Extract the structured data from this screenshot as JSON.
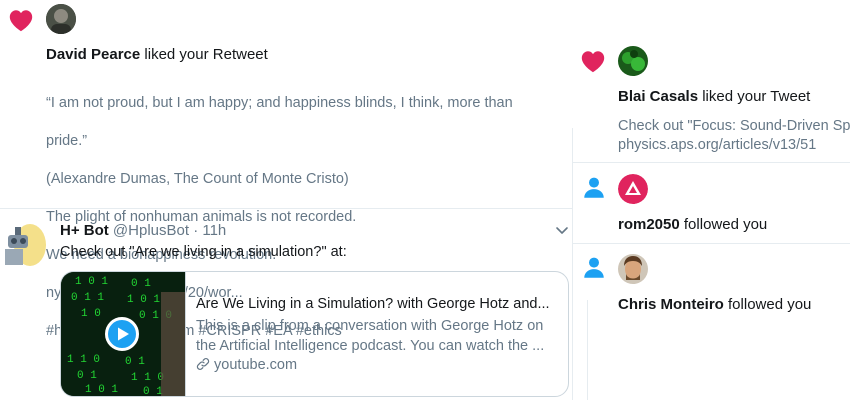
{
  "notif_retweet": {
    "user": "David Pearce",
    "action": "liked your Retweet",
    "lines": [
      "“I am not proud, but I am happy; and happiness blinds, I think, more than",
      "pride.”",
      "(Alexandre Dumas, The Count of Monte Cristo)",
      "The plight of nonhuman animals is not recorded.",
      "We need a biohappiness revolution.",
      "nytimes.com/2020/03/20/wor...",
      "#happiness #veganism #CRISPR #EA #ethics"
    ]
  },
  "tweet": {
    "name": "H+ Bot",
    "handle": "@HplusBot",
    "dot": "·",
    "time": "11h",
    "text": "Check out \"Are we living in a simulation?\" at:",
    "card": {
      "title": "Are We Living in a Simulation? with George Hotz and...",
      "desc_line1": "This is a clip from a conversation with George Hotz on",
      "desc_line2": "the Artificial Intelligence podcast. You can watch the ...",
      "domain": "youtube.com"
    }
  },
  "notif_like": {
    "user": "Blai Casals",
    "action": "liked your Tweet",
    "line1": "Check out \"Focus: Sound-Driven Sp",
    "line2": "physics.aps.org/articles/v13/51"
  },
  "notif_follow1": {
    "user": "rom2050",
    "action": "followed you"
  },
  "notif_follow2": {
    "user": "Chris Monteiro",
    "action": "followed you"
  },
  "colors": {
    "heart": "#e0245e",
    "follow_icon": "#1da1f2",
    "play": "#1da1f2",
    "matrix_green": "#1bd12e"
  },
  "icons": [
    "heart-icon",
    "person-icon",
    "chevron-down-icon",
    "link-icon",
    "play-icon"
  ]
}
